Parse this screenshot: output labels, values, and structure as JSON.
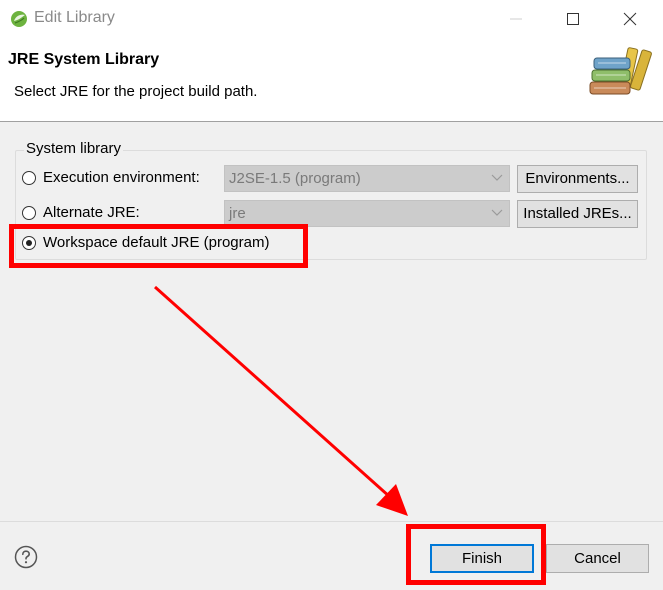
{
  "window": {
    "title": "Edit Library",
    "icon": "eclipse-app-icon"
  },
  "header": {
    "title": "JRE System Library",
    "description": "Select JRE for the project build path.",
    "icon": "library-books-icon"
  },
  "group": {
    "label": "System library",
    "options": [
      {
        "label": "Execution environment:",
        "checked": false,
        "combo_value": "J2SE-1.5 (program)",
        "button_label": "Environments..."
      },
      {
        "label": "Alternate JRE:",
        "checked": false,
        "combo_value": "jre",
        "button_label": "Installed JREs..."
      },
      {
        "label": "Workspace default JRE (program)",
        "checked": true
      }
    ]
  },
  "footer": {
    "help_icon": "help-icon",
    "finish_label": "Finish",
    "cancel_label": "Cancel"
  },
  "annotations": {
    "highlight_color": "#ff0000"
  }
}
